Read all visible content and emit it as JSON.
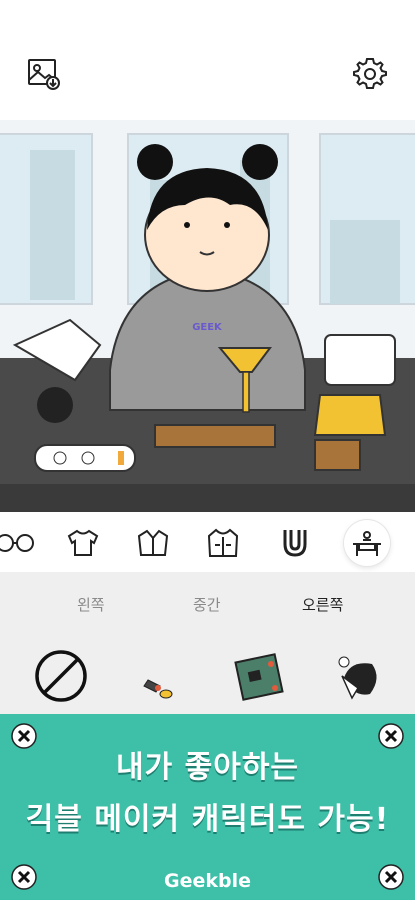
{
  "header": {
    "save_icon": "image-download-icon",
    "settings_icon": "gear-icon"
  },
  "toolbar": {
    "categories": [
      {
        "icon": "glasses-icon",
        "selected": false
      },
      {
        "icon": "tshirt-icon",
        "selected": false
      },
      {
        "icon": "shirt-icon",
        "selected": false
      },
      {
        "icon": "jacket-icon",
        "selected": false
      },
      {
        "icon": "magnet-icon",
        "selected": false
      },
      {
        "icon": "desk-icon",
        "selected": true
      }
    ]
  },
  "position_tabs": {
    "left": "왼쪽",
    "center": "중간",
    "right": "오른쪽",
    "active": "right"
  },
  "items": [
    {
      "icon": "none-icon"
    },
    {
      "icon": "tool-item-icon"
    },
    {
      "icon": "circuit-board-icon"
    },
    {
      "icon": "robot-head-icon"
    }
  ],
  "banner": {
    "line1": "내가 좋아하는",
    "line2": "긱블 메이커 캐릭터도 가능!",
    "brand": "Geekble",
    "background": "#3dbfa8"
  },
  "scene": {
    "hoodie_logo": "GEEK"
  }
}
